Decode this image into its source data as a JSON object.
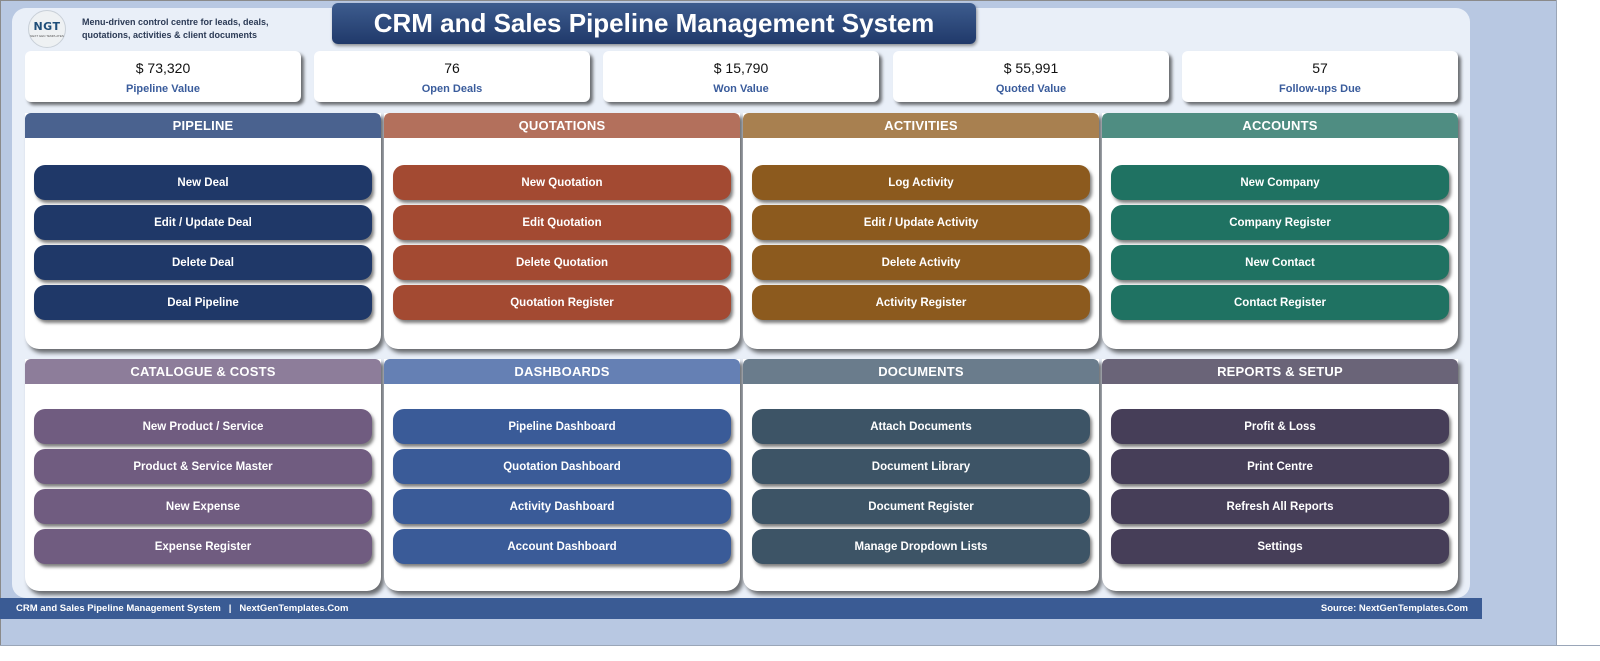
{
  "header": {
    "logo_text": "NGT",
    "logo_subtext": "NEXT GEN TEMPLATES",
    "tagline": "Menu-driven control centre for leads, deals, quotations, activities & client documents",
    "title": "CRM and Sales Pipeline Management System"
  },
  "kpis": [
    {
      "value": "$ 73,320",
      "label": "Pipeline Value"
    },
    {
      "value": "76",
      "label": "Open Deals"
    },
    {
      "value": "$ 15,790",
      "label": "Won Value"
    },
    {
      "value": "$ 55,991",
      "label": "Quoted Value"
    },
    {
      "value": "57",
      "label": "Follow-ups Due"
    }
  ],
  "panels": [
    {
      "title": "PIPELINE",
      "header_color": "#4a628f",
      "button_color": "#1f3868",
      "buttons": [
        "New Deal",
        "Edit / Update Deal",
        "Delete Deal",
        "Deal Pipeline"
      ]
    },
    {
      "title": "QUOTATIONS",
      "header_color": "#b3705c",
      "button_color": "#a34a32",
      "buttons": [
        "New Quotation",
        "Edit Quotation",
        "Delete Quotation",
        "Quotation Register"
      ]
    },
    {
      "title": "ACTIVITIES",
      "header_color": "#a88050",
      "button_color": "#8c5a1e",
      "buttons": [
        "Log Activity",
        "Edit / Update Activity",
        "Delete Activity",
        "Activity Register"
      ]
    },
    {
      "title": "ACCOUNTS",
      "header_color": "#4f8d82",
      "button_color": "#1f7262",
      "buttons": [
        "New Company",
        "Company Register",
        "New Contact",
        "Contact Register"
      ]
    },
    {
      "title": "CATALOGUE & COSTS",
      "header_color": "#8d7d9a",
      "button_color": "#705c80",
      "buttons": [
        "New Product / Service",
        "Product & Service Master",
        "New Expense",
        "Expense Register"
      ]
    },
    {
      "title": "DASHBOARDS",
      "header_color": "#6580b4",
      "button_color": "#3a5b98",
      "buttons": [
        "Pipeline Dashboard",
        "Quotation Dashboard",
        "Activity Dashboard",
        "Account Dashboard"
      ]
    },
    {
      "title": "DOCUMENTS",
      "header_color": "#6a7c8c",
      "button_color": "#3d5466",
      "buttons": [
        "Attach Documents",
        "Document Library",
        "Document Register",
        "Manage Dropdown Lists"
      ]
    },
    {
      "title": "REPORTS & SETUP",
      "header_color": "#6a6478",
      "button_color": "#463e58",
      "buttons": [
        "Profit & Loss",
        "Print Centre",
        "Refresh All Reports",
        "Settings"
      ]
    }
  ],
  "footer": {
    "left": "CRM and Sales Pipeline Management System   |   NextGenTemplates.Com",
    "right": "Source: NextGenTemplates.Com"
  }
}
